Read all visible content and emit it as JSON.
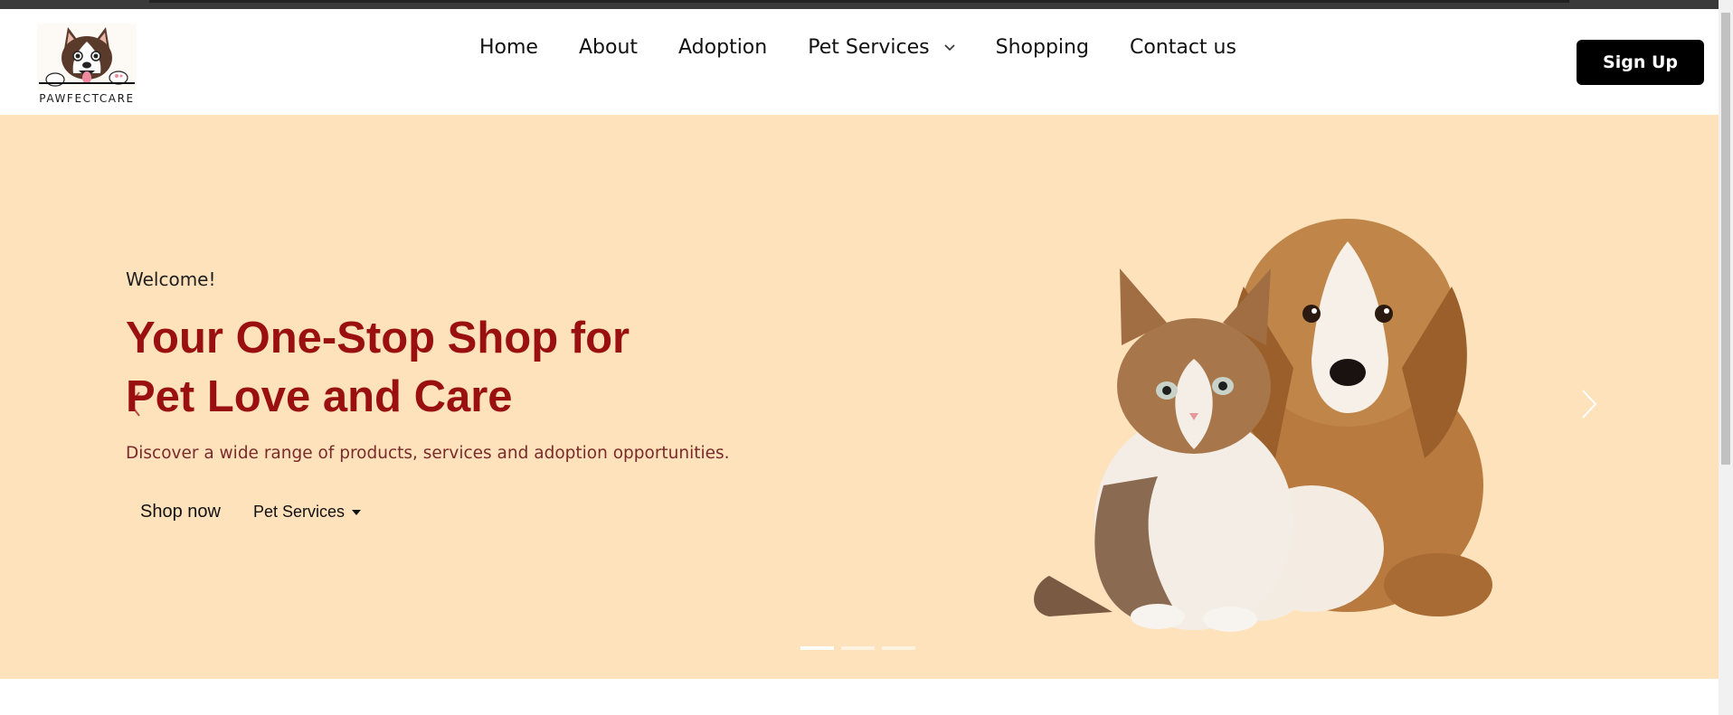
{
  "brand": {
    "name": "PAWFECTCARE"
  },
  "nav": {
    "items": [
      {
        "label": "Home"
      },
      {
        "label": "About"
      },
      {
        "label": "Adoption"
      },
      {
        "label": "Pet Services"
      },
      {
        "label": "Shopping"
      },
      {
        "label": "Contact us"
      }
    ],
    "signup_label": "Sign Up"
  },
  "hero": {
    "welcome": "Welcome!",
    "headline_line1": "Your One-Stop Shop for",
    "headline_line2": "Pet Love and Care",
    "tagline": "Discover a wide range of products, services and adoption opportunities.",
    "shop_label": "Shop now",
    "services_label": "Pet Services",
    "slide_count": 3,
    "active_slide": 1
  },
  "icons": {
    "dropdown": "chevron-down-icon",
    "prev": "chevron-left-icon",
    "next": "chevron-right-icon",
    "caret": "caret-down-icon"
  },
  "colors": {
    "hero_bg": "#fee2bb",
    "headline": "#9a1010",
    "tagline": "#7a2a2a",
    "signup_bg": "#000000",
    "signup_text": "#ffffff"
  }
}
